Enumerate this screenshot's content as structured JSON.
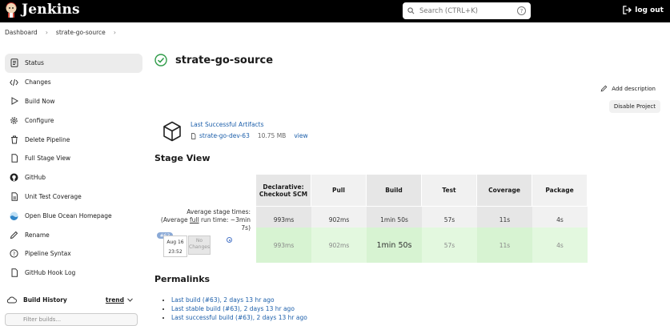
{
  "header": {
    "brand": "Jenkins",
    "search_placeholder": "Search (CTRL+K)",
    "search_help": "?",
    "logout_label": "log out"
  },
  "breadcrumb": [
    "Dashboard",
    "strate-go-source"
  ],
  "sidebar": {
    "items": [
      {
        "label": "Status",
        "icon": "status-icon"
      },
      {
        "label": "Changes",
        "icon": "code-icon"
      },
      {
        "label": "Build Now",
        "icon": "play-icon"
      },
      {
        "label": "Configure",
        "icon": "gear-icon"
      },
      {
        "label": "Delete Pipeline",
        "icon": "trash-icon"
      },
      {
        "label": "Full Stage View",
        "icon": "file-icon"
      },
      {
        "label": "GitHub",
        "icon": "github-icon"
      },
      {
        "label": "Unit Test Coverage",
        "icon": "file-icon"
      },
      {
        "label": "Open Blue Ocean Homepage",
        "icon": "blue-ocean-icon"
      },
      {
        "label": "Rename",
        "icon": "pencil-icon"
      },
      {
        "label": "Pipeline Syntax",
        "icon": "help-icon"
      },
      {
        "label": "GitHub Hook Log",
        "icon": "file-icon"
      }
    ],
    "build_history": {
      "label": "Build History",
      "trend_label": "trend"
    },
    "filter_placeholder": "Filter builds..."
  },
  "main": {
    "title": "strate-go-source",
    "add_description": "Add description",
    "disable_project": "Disable Project",
    "artifacts": {
      "title": "Last Successful Artifacts",
      "file": "strate-go-dev-63",
      "size": "10.75 MB",
      "view": "view"
    },
    "stage_view_title": "Stage View",
    "stage_view": {
      "avg_stage_label": "Average stage times:",
      "avg_full_label_pre": "(Average ",
      "avg_full_word": "full",
      "avg_full_label_post": " run time: ~3min 7s)",
      "stages": [
        {
          "name": "Declarative: Checkout SCM",
          "avg": "993ms",
          "run": "993ms",
          "fill": 0.05
        },
        {
          "name": "Pull",
          "avg": "902ms",
          "run": "902ms",
          "fill": 0.05
        },
        {
          "name": "Build",
          "avg": "1min 50s",
          "run": "1min 50s",
          "fill": 0.6
        },
        {
          "name": "Test",
          "avg": "57s",
          "run": "57s",
          "fill": 0.3
        },
        {
          "name": "Coverage",
          "avg": "11s",
          "run": "11s",
          "fill": 0.1
        },
        {
          "name": "Package",
          "avg": "4s",
          "run": "4s",
          "fill": 0.05
        }
      ],
      "build": {
        "number": "#63",
        "date": "Aug 16",
        "time": "23:52",
        "changes": "No Changes"
      }
    },
    "permalinks_title": "Permalinks",
    "permalinks": [
      "Last build (#63), 2 days 13 hr ago",
      "Last stable build (#63), 2 days 13 hr ago",
      "Last successful build (#63), 2 days 13 hr ago"
    ]
  }
}
